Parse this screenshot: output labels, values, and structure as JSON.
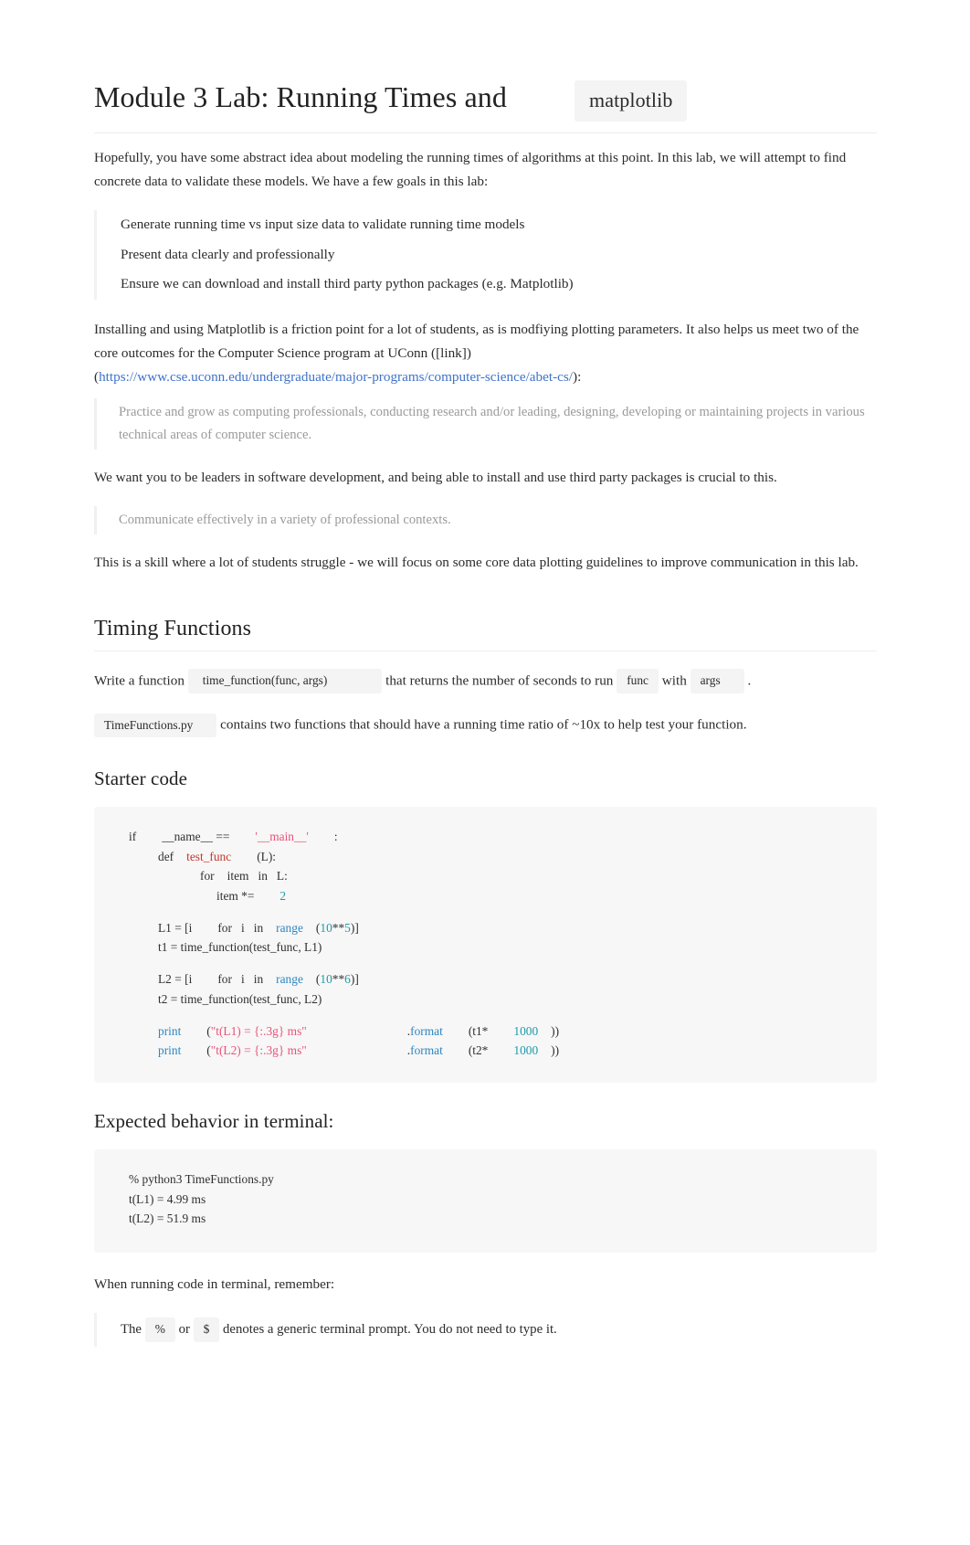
{
  "title": {
    "text": "Module 3 Lab: Running Times and",
    "code": "matplotlib"
  },
  "intro": {
    "paragraph": "Hopefully, you have some abstract idea about modeling the running times of algorithms at this point. In this lab, we will attempt to find concrete data to validate these models. We have a few goals in this lab:",
    "goals": [
      "Generate running time vs input size data to validate running time models",
      "Present data clearly and professionally",
      "Ensure we can download and install third party python packages (e.g. Matplotlib)"
    ],
    "matplotlib_paragraph": "Installing and using Matplotlib is a friction point for a lot of students, as is modfiying plotting parameters. It also helps us meet two of the core outcomes for the Computer Science program at UConn ([link])",
    "link_open_paren": "(",
    "link_text": "https://www.cse.uconn.edu/undergraduate/major-programs/computer-science/abet-cs/",
    "link_close_paren": "):",
    "outcome_one": "Practice and grow as computing professionals, conducting research and/or leading, designing, developing or maintaining projects in various technical areas of computer science.",
    "leaders_paragraph": "We want you to be leaders in software development, and being able to install and use third party packages is crucial to this.",
    "outcome_two": "Communicate effectively in a variety of professional contexts.",
    "closing_paragraph": "This is a skill where a lot of students struggle - we will focus on some core data plotting guidelines to improve communication in this lab."
  },
  "timing": {
    "heading": "Timing Functions",
    "write_prefix": "Write a function",
    "signature_code": "time_function(func, args)",
    "write_middle": "that returns the number of seconds to run",
    "func_code": "func",
    "with_word": "with",
    "args_code": "args",
    "period": ".",
    "file_code": "TimeFunctions.py",
    "file_sentence": "contains two functions that should have a running time ratio of ~10x to help test your function."
  },
  "starter": {
    "heading": "Starter code",
    "code_lines": {
      "l1_kw": "if",
      "l1_name": "__name__ ==",
      "l1_str": "'__main__'",
      "l1_colon": ":",
      "l2_def": "def",
      "l2_fn": "test_func",
      "l2_args": "(L):",
      "l3_for": "for",
      "l3_rest": "item   in   L:",
      "l4": "item *=",
      "l4_num": "2",
      "l5_a": "L1 = [i",
      "l5_for": "for   i   in",
      "l5_range": "range",
      "l5_open": "(",
      "l5_n1": "10",
      "l5_op": "**",
      "l5_n2": "5",
      "l5_close": ")]",
      "l6": "t1 = time_function(test_func, L1)",
      "l7_a": "L2 = [i",
      "l7_for": "for   i   in",
      "l7_range": "range",
      "l7_open": "(",
      "l7_n1": "10",
      "l7_op": "**",
      "l7_n2": "6",
      "l7_close": ")]",
      "l8": "t2 = time_function(test_func, L2)",
      "l9_print": "print",
      "l9_open": "(",
      "l9_str": "\"t(L1) = {:.3g} ms\"",
      "l9_dot": ".",
      "l9_format": "format",
      "l9_args": "(t1*",
      "l9_num": "1000",
      "l9_close": "))",
      "l10_print": "print",
      "l10_open": "(",
      "l10_str": "\"t(L2) = {:.3g} ms\"",
      "l10_dot": ".",
      "l10_format": "format",
      "l10_args": "(t2*",
      "l10_num": "1000",
      "l10_close": "))"
    }
  },
  "terminal": {
    "heading": "Expected behavior in terminal:",
    "lines": [
      "% python3 TimeFunctions.py",
      "t(L1) = 4.99 ms",
      "t(L2) = 51.9 ms"
    ],
    "remember_paragraph": "When running code in terminal, remember:",
    "note_prefix": "The",
    "note_percent": "%",
    "note_or": "or",
    "note_dollar": "$",
    "note_suffix": "denotes a generic terminal prompt. You do not need to type it."
  },
  "colors": {
    "link": "#3f72c8",
    "code_bg": "#f7f7f7",
    "inline_code_bg": "#f4f4f4",
    "string": "#e8527a",
    "function": "#c0392b",
    "number": "#1d9aa8",
    "builtin": "#2e86c1"
  }
}
